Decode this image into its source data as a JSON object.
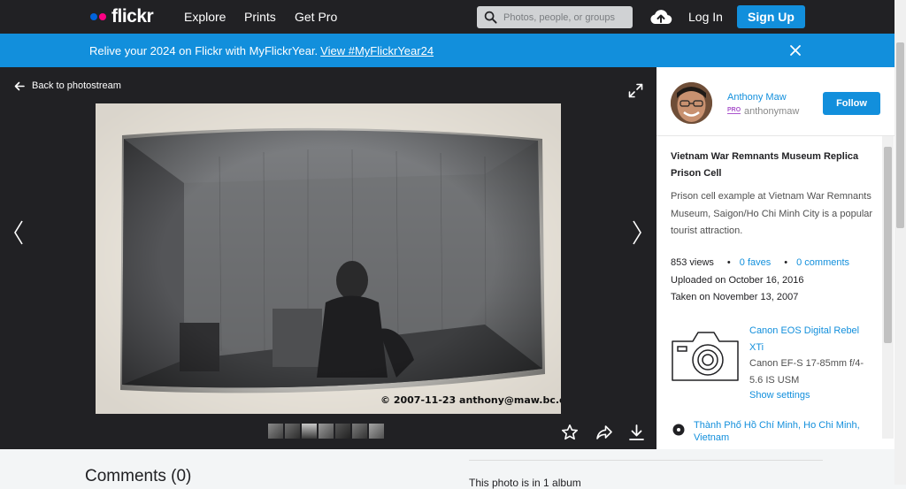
{
  "nav": {
    "logo": "flickr",
    "explore": "Explore",
    "prints": "Prints",
    "get_pro": "Get Pro",
    "search_placeholder": "Photos, people, or groups",
    "login": "Log In",
    "signup": "Sign Up"
  },
  "banner": {
    "text": "Relive your 2024 on Flickr with MyFlickrYear.",
    "link": "View #MyFlickrYear24"
  },
  "viewer": {
    "back_label": "Back to photostream",
    "watermark": "© 2007-11-23 anthony@maw.bc.ca",
    "thumbnail_count": 7
  },
  "owner": {
    "name": "Anthony Maw",
    "badge": "PRO",
    "username": "anthonymaw",
    "follow_label": "Follow"
  },
  "photo": {
    "title": "Vietnam War Remnants Museum Replica Prison Cell",
    "description": "Prison cell example at Vietnam War Remnants Museum, Saigon/Ho Chi Minh City is a popular tourist attraction.",
    "views": "853 views",
    "faves": "0 faves",
    "comments": "0 comments",
    "uploaded": "Uploaded on October 16, 2016",
    "taken": "Taken on November 13, 2007",
    "camera": "Canon EOS Digital Rebel XTi",
    "lens": "Canon EF-S 17-85mm f/4-5.6 IS USM",
    "show_settings": "Show settings",
    "location": "Thành Phố Hồ Chí Minh, Ho Chi Minh, Vietnam"
  },
  "below": {
    "comments_title": "Comments (0)",
    "album_text": "This photo is in 1 album"
  },
  "colors": {
    "brand_blue": "#128fdc",
    "brand_pink": "#ff0084",
    "nav_bg": "#212124"
  }
}
